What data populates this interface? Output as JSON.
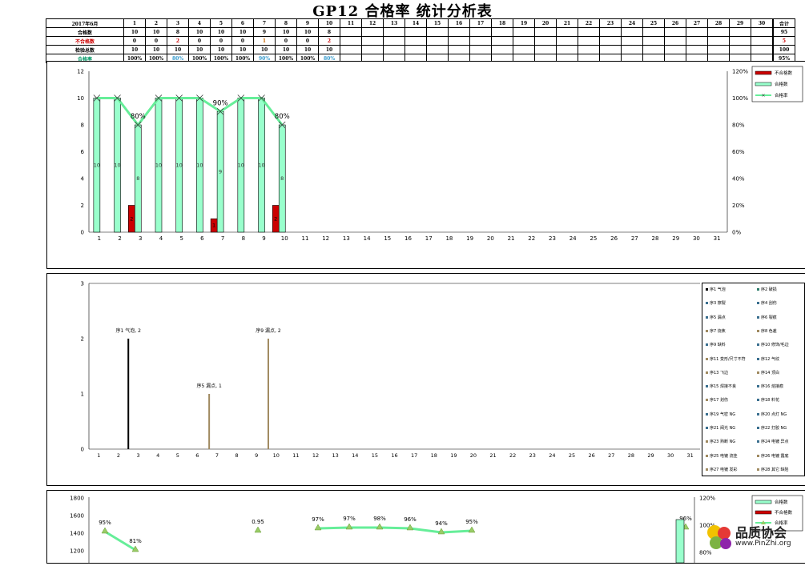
{
  "title": "GP12 合格率 统计分析表",
  "table": {
    "corner": "2017年6月",
    "columns": [
      "1",
      "2",
      "3",
      "4",
      "5",
      "6",
      "7",
      "8",
      "9",
      "10",
      "11",
      "12",
      "13",
      "14",
      "15",
      "16",
      "17",
      "18",
      "19",
      "20",
      "21",
      "22",
      "23",
      "24",
      "25",
      "26",
      "27",
      "28",
      "29",
      "30"
    ],
    "total_header": "合计",
    "rows": [
      {
        "label": "合格数",
        "label_color": "#000000",
        "values": [
          "10",
          "10",
          "8",
          "10",
          "10",
          "10",
          "9",
          "10",
          "10",
          "8"
        ],
        "total": "95"
      },
      {
        "label": "不合格数",
        "label_color": "#cc0000",
        "values": [
          "0",
          "0",
          "2",
          "0",
          "0",
          "0",
          "1",
          "0",
          "0",
          "2"
        ],
        "total": "5"
      },
      {
        "label": "检验总数",
        "label_color": "#000000",
        "values": [
          "10",
          "10",
          "10",
          "10",
          "10",
          "10",
          "10",
          "10",
          "10",
          "10"
        ],
        "total": "100"
      },
      {
        "label": "合格率",
        "label_color": "#009966",
        "values": [
          "100%",
          "100%",
          "80%",
          "100%",
          "100%",
          "100%",
          "90%",
          "100%",
          "100%",
          "80%"
        ],
        "total": "95%"
      }
    ]
  },
  "chart_data": [
    {
      "type": "bar",
      "categories": [
        "1",
        "2",
        "3",
        "4",
        "5",
        "6",
        "7",
        "8",
        "9",
        "10",
        "11",
        "12",
        "13",
        "14",
        "15",
        "16",
        "17",
        "18",
        "19",
        "20",
        "21",
        "22",
        "23",
        "24",
        "25",
        "26",
        "27",
        "28",
        "29",
        "30",
        "31"
      ],
      "series": [
        {
          "name": "合格数",
          "kind": "bar",
          "color": "#99ffcc",
          "values": [
            10,
            10,
            8,
            10,
            10,
            10,
            9,
            10,
            10,
            8
          ]
        },
        {
          "name": "不合格数",
          "kind": "bar",
          "color": "#cc0000",
          "values": [
            0,
            0,
            2,
            0,
            0,
            0,
            1,
            0,
            0,
            2
          ]
        },
        {
          "name": "合格率",
          "kind": "line",
          "color": "#66ee99",
          "values": [
            1.0,
            1.0,
            0.8,
            1.0,
            1.0,
            1.0,
            0.9,
            1.0,
            1.0,
            0.8
          ]
        }
      ],
      "ylim": [
        0,
        12
      ],
      "yticks": [
        "0",
        "2",
        "4",
        "6",
        "8",
        "10",
        "12"
      ],
      "y2lim": [
        0,
        1.2
      ],
      "y2ticks": [
        "0%",
        "20%",
        "40%",
        "60%",
        "80%",
        "100%",
        "120%"
      ],
      "point_labels": [
        {
          "index": 2,
          "text": "80%"
        },
        {
          "index": 6,
          "text": "90%"
        },
        {
          "index": 9,
          "text": "80%"
        }
      ],
      "legend": "top-right"
    },
    {
      "type": "bar",
      "categories": [
        "1",
        "2",
        "3",
        "4",
        "5",
        "6",
        "7",
        "8",
        "9",
        "10",
        "11",
        "12",
        "13",
        "14",
        "15",
        "16",
        "17",
        "18",
        "19",
        "20",
        "21",
        "22",
        "23",
        "24",
        "25",
        "26",
        "27",
        "28",
        "29",
        "30",
        "31"
      ],
      "ylim": [
        0,
        3
      ],
      "yticks": [
        "0",
        "1",
        "2",
        "3"
      ],
      "bars": [
        {
          "x": 2.5,
          "value": 2,
          "color": "#000000",
          "label": "序1 气泡, 2"
        },
        {
          "x": 6.6,
          "value": 1,
          "color": "#a08a60",
          "label": "序5 漏点, 1"
        },
        {
          "x": 9.6,
          "value": 2,
          "color": "#a08a60",
          "label": "序9 漏点, 2"
        }
      ],
      "legend": "right",
      "legend_items": [
        {
          "label": "序1 气泡",
          "color": "#000000"
        },
        {
          "label": "序2 破损",
          "color": "#2e7d6b"
        },
        {
          "label": "序3 擦裂",
          "color": "#3a6f8f"
        },
        {
          "label": "序4 刮伤",
          "color": "#3a6f8f"
        },
        {
          "label": "序5 漏点",
          "color": "#3a6f8f"
        },
        {
          "label": "序6 裂痕",
          "color": "#3a6f8f"
        },
        {
          "label": "序7 烧焦",
          "color": "#a08a60"
        },
        {
          "label": "序8 色差",
          "color": "#a08a60"
        },
        {
          "label": "序9 缺料",
          "color": "#3a6f8f"
        },
        {
          "label": "序10 修饰/毛边",
          "color": "#3a6f8f"
        },
        {
          "label": "序11 变形/尺寸不符",
          "color": "#a08a60"
        },
        {
          "label": "序12 气纹",
          "color": "#3a6f8f"
        },
        {
          "label": "序13 飞边",
          "color": "#a08a60"
        },
        {
          "label": "序14 顶白",
          "color": "#a08a60"
        },
        {
          "label": "序15 焊接不良",
          "color": "#3a6f8f"
        },
        {
          "label": "序16 熔接痕",
          "color": "#3a6f8f"
        },
        {
          "label": "序17 划伤",
          "color": "#a08a60"
        },
        {
          "label": "序18 料花",
          "color": "#3a6f8f"
        },
        {
          "label": "序19 气密 NG",
          "color": "#3a6f8f"
        },
        {
          "label": "序20 点灯 NG",
          "color": "#3a6f8f"
        },
        {
          "label": "序21 阀光 NG",
          "color": "#3a6f8f"
        },
        {
          "label": "序22 打胶 NG",
          "color": "#3a6f8f"
        },
        {
          "label": "序23 熟断 NG",
          "color": "#a08a60"
        },
        {
          "label": "序24 电镀 异点",
          "color": "#3a6f8f"
        },
        {
          "label": "序25 电镀 流挂",
          "color": "#a08a60"
        },
        {
          "label": "序26 电镀 露底",
          "color": "#a08a60"
        },
        {
          "label": "序27 电镀 发彩",
          "color": "#a08a60"
        },
        {
          "label": "序28 其它 缺陷",
          "color": "#a08a60"
        }
      ]
    },
    {
      "type": "bar",
      "series": [
        {
          "name": "合格数",
          "kind": "bar",
          "color": "#99ffcc"
        },
        {
          "name": "不合格数",
          "kind": "bar",
          "color": "#cc0000"
        },
        {
          "name": "合格率",
          "kind": "line",
          "color": "#66ee99"
        }
      ],
      "yticks": [
        "1200",
        "1400",
        "1600",
        "1800"
      ],
      "y2ticks": [
        "80%",
        "100%",
        "120%"
      ],
      "point_labels": [
        "95%",
        "81%",
        "0.95",
        "97%",
        "97%",
        "98%",
        "96%",
        "94%",
        "95%",
        "96%"
      ],
      "legend": "top-right"
    }
  ],
  "logo": {
    "text": "品质协会",
    "url": "www.PinZhi.org"
  }
}
